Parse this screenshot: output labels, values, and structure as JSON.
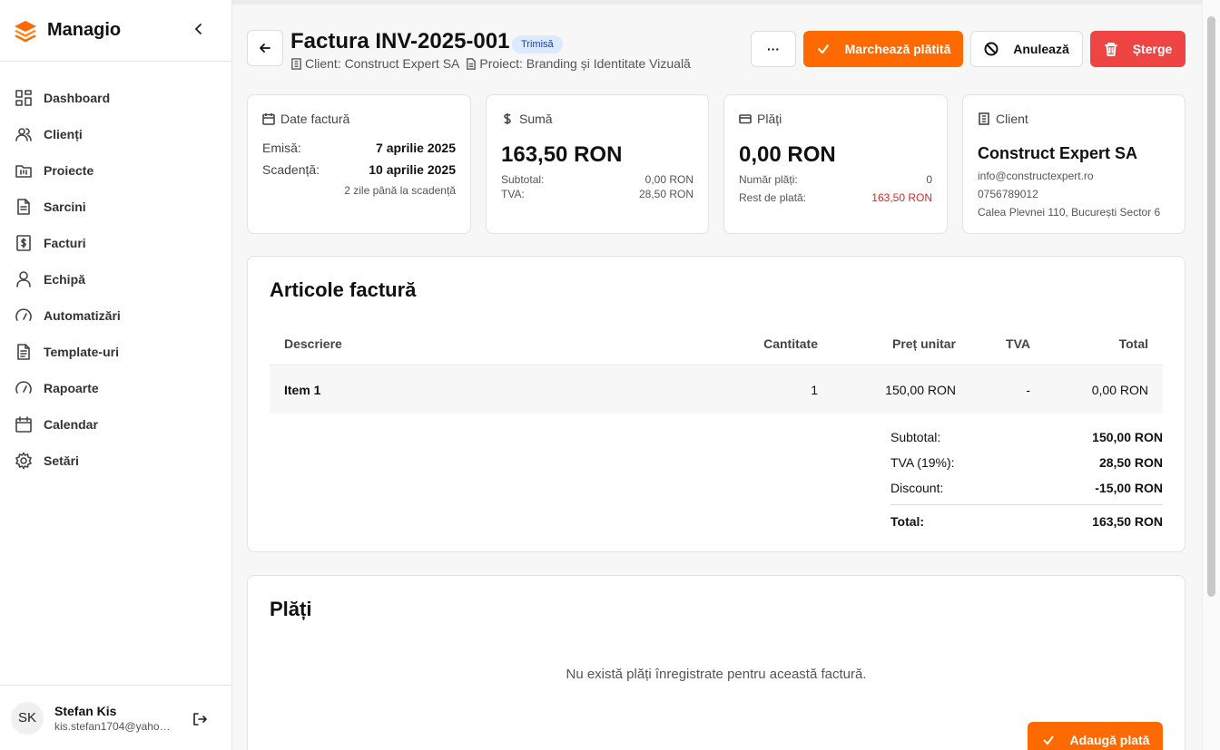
{
  "app": {
    "name": "Managio"
  },
  "sidebar": {
    "items": [
      {
        "label": "Dashboard",
        "icon": "dashboard-icon"
      },
      {
        "label": "Clienți",
        "icon": "users-icon"
      },
      {
        "label": "Proiecte",
        "icon": "folder-icon"
      },
      {
        "label": "Sarcini",
        "icon": "document-icon"
      },
      {
        "label": "Facturi",
        "icon": "invoice-icon"
      },
      {
        "label": "Echipă",
        "icon": "user-icon"
      },
      {
        "label": "Automatizări",
        "icon": "gauge-icon"
      },
      {
        "label": "Template-uri",
        "icon": "template-icon"
      },
      {
        "label": "Rapoarte",
        "icon": "gauge-icon"
      },
      {
        "label": "Calendar",
        "icon": "calendar-icon"
      },
      {
        "label": "Setări",
        "icon": "gear-icon"
      }
    ]
  },
  "user": {
    "initials": "SK",
    "name": "Stefan Kis",
    "email": "kis.stefan1704@yahoo.com"
  },
  "header": {
    "title": "Factura INV-2025-001",
    "status": "Trimisă",
    "client": "Client: Construct Expert SA",
    "project": "Proiect: Branding și Identitate Vizuală",
    "more_label": "···",
    "mark_paid_label": "Marchează plătită",
    "cancel_label": "Anulează",
    "delete_label": "Șterge"
  },
  "cards": {
    "dates": {
      "title": "Date factură",
      "issued_label": "Emisă:",
      "issued": "7 aprilie 2025",
      "due_label": "Scadență:",
      "due": "10 aprilie 2025",
      "note": "2 zile până la scadență"
    },
    "amount": {
      "title": "Sumă",
      "total": "163,50 RON",
      "subtotal_label": "Subtotal:",
      "subtotal": "0,00 RON",
      "vat_label": "TVA:",
      "vat": "28,50 RON"
    },
    "payments": {
      "title": "Plăți",
      "total": "0,00 RON",
      "count_label": "Număr plăți:",
      "count": "0",
      "rest_label": "Rest de plată:",
      "rest": "163,50 RON"
    },
    "client": {
      "title": "Client",
      "name": "Construct Expert SA",
      "email": "info@constructexpert.ro",
      "phone": "0756789012",
      "address": "Calea Plevnei 110, București Sector 6"
    }
  },
  "items": {
    "title": "Articole factură",
    "columns": {
      "desc": "Descriere",
      "qty": "Cantitate",
      "price": "Preț unitar",
      "vat": "TVA",
      "total": "Total"
    },
    "rows": [
      {
        "desc": "Item 1",
        "qty": "1",
        "price": "150,00 RON",
        "vat": "-",
        "total": "0,00 RON"
      }
    ],
    "totals": {
      "subtotal_label": "Subtotal:",
      "subtotal": "150,00 RON",
      "vat_label": "TVA (19%):",
      "vat": "28,50 RON",
      "discount_label": "Discount:",
      "discount": "-15,00 RON",
      "total_label": "Total:",
      "total": "163,50 RON"
    }
  },
  "payments_section": {
    "title": "Plăți",
    "empty": "Nu există plăți înregistrate pentru această factură.",
    "add_label": "Adaugă plată"
  },
  "colors": {
    "accent": "#ff6a00",
    "danger": "#ef4444",
    "badge_bg": "#dbeafe",
    "badge_text": "#1e40af"
  }
}
